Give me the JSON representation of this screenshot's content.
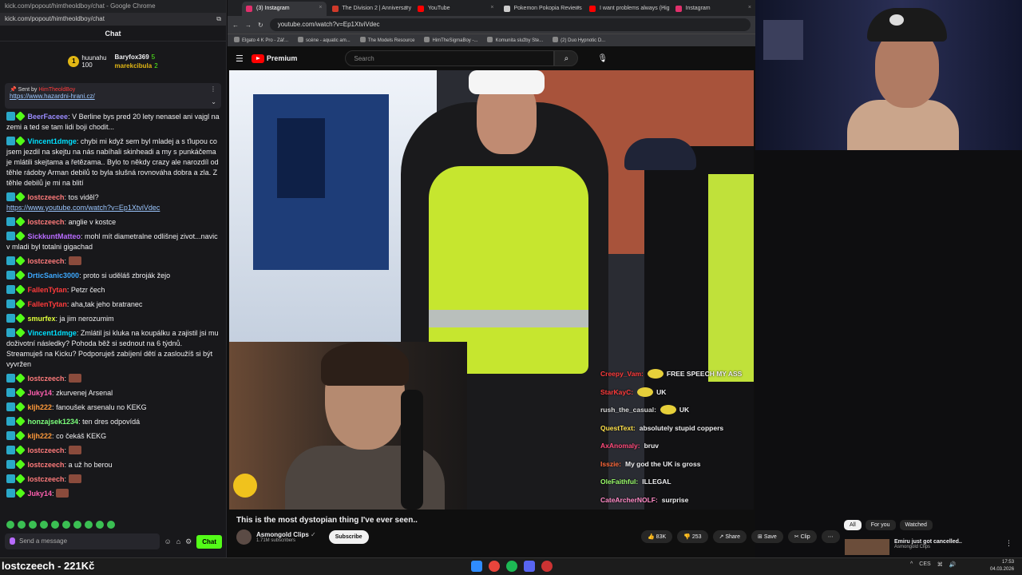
{
  "chat_window": {
    "title_bar": "kick.com/popout/himtheoldboy/chat - Google Chrome",
    "url": "kick.com/popout/himtheoldboy/chat",
    "header": "Chat",
    "leaderboard": [
      {
        "rank": "1",
        "name": "huunahu",
        "amount": "100"
      },
      {
        "name": "Baryfox369",
        "amount": "5"
      },
      {
        "name": "marekcibula",
        "amount": "2"
      }
    ],
    "pinned": {
      "sent_by": "Sent by",
      "sender": "HimTheoldBoy",
      "link": "https://www.hazardni-hrani.cz/"
    },
    "messages": [
      {
        "user": "BeerFaceee",
        "color": "#9b8cff",
        "text": "V Berline bys pred 20 lety nenasel ani vajgl na zemi a ted se tam lidi boji chodit..."
      },
      {
        "user": "Vincent1dmge",
        "color": "#00e0ff",
        "text": "chybi mi když sem byl mladej a s ťlupou co jsem jezdil na skejtu na nás nabíhali skinheadi a my s punkáčema je mlátili skejtama a řetězama.. Bylo to někdy crazy ale narozdíl od těhle rádoby Arman debilů to byla slušná rovnováha dobra a zla. Z těhle debilů je mi na blití"
      },
      {
        "user": "lostczeech",
        "color": "#ff7b7b",
        "text": "tos viděl?",
        "link": "https://www.youtube.com/watch?v=Ep1XtviVdec"
      },
      {
        "user": "lostczeech",
        "color": "#ff7b7b",
        "text": "anglie v kostce"
      },
      {
        "user": "SickkuntMatteo",
        "color": "#b96cff",
        "text": "mohl mít diametralne odlišnej zivot...navic v mladi byl totalni gigachad"
      },
      {
        "user": "lostczeech",
        "color": "#ff7b7b",
        "text": ""
      },
      {
        "user": "DrticSanic3000",
        "color": "#3da9ff",
        "text": "proto si uděláš zbroják žejo"
      },
      {
        "user": "FallenTytan",
        "color": "#ff3b3b",
        "text": "Petzr čech"
      },
      {
        "user": "FallenTytan",
        "color": "#ff3b3b",
        "text": "aha,tak jeho bratranec"
      },
      {
        "user": "smurfex",
        "color": "#e0ff3a",
        "text": "ja jim nerozumim"
      },
      {
        "user": "Vincent1dmge",
        "color": "#00e0ff",
        "text": "Zmlátil jsi kluka na koupálku a zajistil jsi mu doživotní následky? Pohoda běž si sednout na 6 týdnů. Streamuješ na Kicku? Podporuješ zabíjení dětí a zasloužíš si být vyvržen"
      },
      {
        "user": "lostczeech",
        "color": "#ff7b7b",
        "text": ""
      },
      {
        "user": "Juky14",
        "color": "#ff5fb0",
        "text": "zkurvenej Arsenal"
      },
      {
        "user": "kljh222",
        "color": "#ff9a3b",
        "text": "fanoušek arsenalu no KEKG"
      },
      {
        "user": "honzajsek1234",
        "color": "#7bff7b",
        "text": "ten dres odpovídá"
      },
      {
        "user": "kljh222",
        "color": "#ff9a3b",
        "text": "co čekáš KEKG"
      },
      {
        "user": "lostczeech",
        "color": "#ff7b7b",
        "text": ""
      },
      {
        "user": "lostczeech",
        "color": "#ff7b7b",
        "text": "a už ho berou"
      },
      {
        "user": "lostczeech",
        "color": "#ff7b7b",
        "text": ""
      },
      {
        "user": "Juky14",
        "color": "#ff5fb0",
        "text": ""
      }
    ],
    "send_placeholder": "Send a message",
    "chat_button": "Chat"
  },
  "browser": {
    "tabs": [
      {
        "label": "(3) Instagram",
        "color": "#e1306c"
      },
      {
        "label": "The Division 2 | Anniversary Se...",
        "color": "#d03a2a"
      },
      {
        "label": "YouTube",
        "color": "#ff0000"
      },
      {
        "label": "Pokemon Pokopia Reviews - M...",
        "color": "#cccccc"
      },
      {
        "label": "I want problems always (High ...",
        "color": "#ff0000"
      },
      {
        "label": "Instagram",
        "color": "#e1306c"
      }
    ],
    "url": "youtube.com/watch?v=Ep1XtviVdec",
    "bookmarks": [
      "Elgato 4 K Pro - Zář...",
      "scéne - aquatic am...",
      "The Models Resource",
      "HimTheSigmaBoy -...",
      "Komunita služby Ste...",
      "(2) Duo Hypnotic D..."
    ],
    "yt": {
      "logo": "Premium",
      "search_placeholder": "Search",
      "video_title": "This is the most dystopian thing I've ever seen..",
      "channel": "Asmongold Clips",
      "subscribers": "1.71M subscribers",
      "subscribe": "Subscribe",
      "likes": "83K",
      "dislikes": "253",
      "share": "Share",
      "save": "Save",
      "clip": "Clip",
      "chips": [
        "All",
        "For you",
        "Watched"
      ],
      "upnext_title": "Emiru just got cancelled..",
      "upnext_channel": "Asmongold Clips"
    }
  },
  "overlay_chat": [
    {
      "user": "Creepy_Vam:",
      "color": "#ff3b3b",
      "text": "FREE SPEECH MY ASS"
    },
    {
      "user": "StarKayC:",
      "color": "#ff3b3b",
      "text": "UK"
    },
    {
      "user": "rush_the_casual:",
      "color": "#d9d9d9",
      "text": "UK"
    },
    {
      "user": "QuestText:",
      "color": "#ffe14a",
      "text": "absolutely stupid coppers"
    },
    {
      "user": "AxAnomaly:",
      "color": "#ff4a7a",
      "text": "bruv"
    },
    {
      "user": "Isszie:",
      "color": "#ff6a3b",
      "text": "My god the UK is gross"
    },
    {
      "user": "OleFaithful:",
      "color": "#9bff6a",
      "text": "ILLEGAL"
    },
    {
      "user": "CateArcherNOLF:",
      "color": "#ff8ac6",
      "text": "surprise"
    }
  ],
  "taskbar": {
    "title": "lostczeech - 221Kč",
    "language": "CES",
    "time": "17:53",
    "date": "04.03.2026"
  }
}
